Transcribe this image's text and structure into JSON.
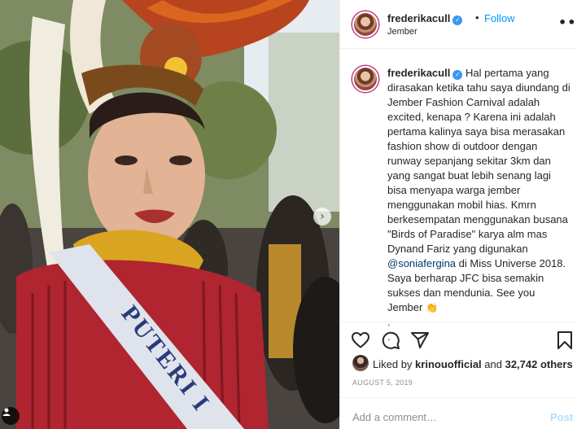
{
  "header": {
    "username": "frederikacull",
    "separator": "•",
    "follow_label": "Follow",
    "location": "Jember",
    "more_label": "•••"
  },
  "caption": {
    "username": "frederikacull",
    "text_part1": "Hal pertama yang dirasakan ketika tahu saya diundang di Jember Fashion Carnival adalah excited, kenapa ? Karena ini adalah pertama kalinya saya bisa merasakan fashion show di outdoor dengan runway sepanjang sekitar 3km dan yang sangat buat lebih senang lagi bisa menyapa warga jember menggunakan mobil hias. Kmrn berkesempatan menggunakan busana \"Birds of Paradise\" karya alm mas Dynand Fariz yang digunakan ",
    "mention": "@soniafergina",
    "text_part2": " di Miss Universe 2018. Saya berharap JFC bisa semakin sukses dan mendunia. See you Jember ",
    "trailing": "\n.\n."
  },
  "icons": {
    "verified": "verified-badge-icon",
    "like": "heart-icon",
    "comment": "comment-icon",
    "share": "paper-plane-icon",
    "save": "bookmark-icon",
    "next": "chevron-right-icon",
    "tag": "user-tag-icon",
    "emoji": "clapping-hands-emoji"
  },
  "likes": {
    "prefix": "Liked by ",
    "user": "krinouofficial",
    "middle": " and ",
    "count": "32,742 others"
  },
  "date": "AUGUST 5, 2019",
  "add_comment": {
    "placeholder": "Add a comment…",
    "post_label": "Post"
  },
  "photo": {
    "sash_text": "PUTERI I",
    "colors": {
      "fringe": "#b0252f",
      "gold": "#d9a520",
      "sash": "#dfe3ec",
      "sash_text": "#2a3a7a"
    }
  },
  "theme": {
    "link_blue": "#0095f6",
    "verified_blue": "#3897f0",
    "muted": "#8e8e8e",
    "border": "#efefef"
  }
}
